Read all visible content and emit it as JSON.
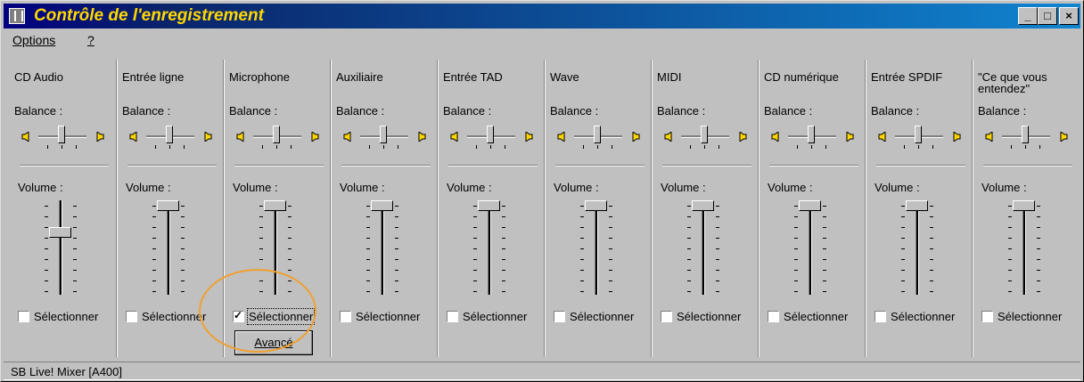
{
  "window": {
    "title": "Contrôle de l'enregistrement",
    "controls": {
      "minimize": "_",
      "maximize": "□",
      "close": "×"
    }
  },
  "menu": {
    "items": [
      "Options",
      "?"
    ]
  },
  "channels": [
    {
      "name": "CD Audio",
      "balance_label": "Balance :",
      "volume_label": "Volume :",
      "select_label": "Sélectionner",
      "selected": false,
      "volume_level": 0.68
    },
    {
      "name": "Entrée ligne",
      "balance_label": "Balance :",
      "volume_label": "Volume :",
      "select_label": "Sélectionner",
      "selected": false,
      "volume_level": 1.0
    },
    {
      "name": "Microphone",
      "balance_label": "Balance :",
      "volume_label": "Volume :",
      "select_label": "Sélectionner",
      "selected": true,
      "volume_level": 1.0
    },
    {
      "name": "Auxiliaire",
      "balance_label": "Balance :",
      "volume_label": "Volume :",
      "select_label": "Sélectionner",
      "selected": false,
      "volume_level": 1.0
    },
    {
      "name": "Entrée TAD",
      "balance_label": "Balance :",
      "volume_label": "Volume :",
      "select_label": "Sélectionner",
      "selected": false,
      "volume_level": 1.0
    },
    {
      "name": "Wave",
      "balance_label": "Balance :",
      "volume_label": "Volume :",
      "select_label": "Sélectionner",
      "selected": false,
      "volume_level": 1.0
    },
    {
      "name": "MIDI",
      "balance_label": "Balance :",
      "volume_label": "Volume :",
      "select_label": "Sélectionner",
      "selected": false,
      "volume_level": 1.0
    },
    {
      "name": "CD numérique",
      "balance_label": "Balance :",
      "volume_label": "Volume :",
      "select_label": "Sélectionner",
      "selected": false,
      "volume_level": 1.0
    },
    {
      "name": "Entrée SPDIF",
      "balance_label": "Balance :",
      "volume_label": "Volume :",
      "select_label": "Sélectionner",
      "selected": false,
      "volume_level": 1.0
    },
    {
      "name": "\"Ce que vous entendez\"",
      "balance_label": "Balance :",
      "volume_label": "Volume :",
      "select_label": "Sélectionner",
      "selected": false,
      "volume_level": 1.0
    }
  ],
  "advanced_button": "Avancé",
  "status": "SB Live! Mixer [A400]",
  "colors": {
    "title_text": "#ffd700",
    "highlight_circle": "#f0a030"
  }
}
